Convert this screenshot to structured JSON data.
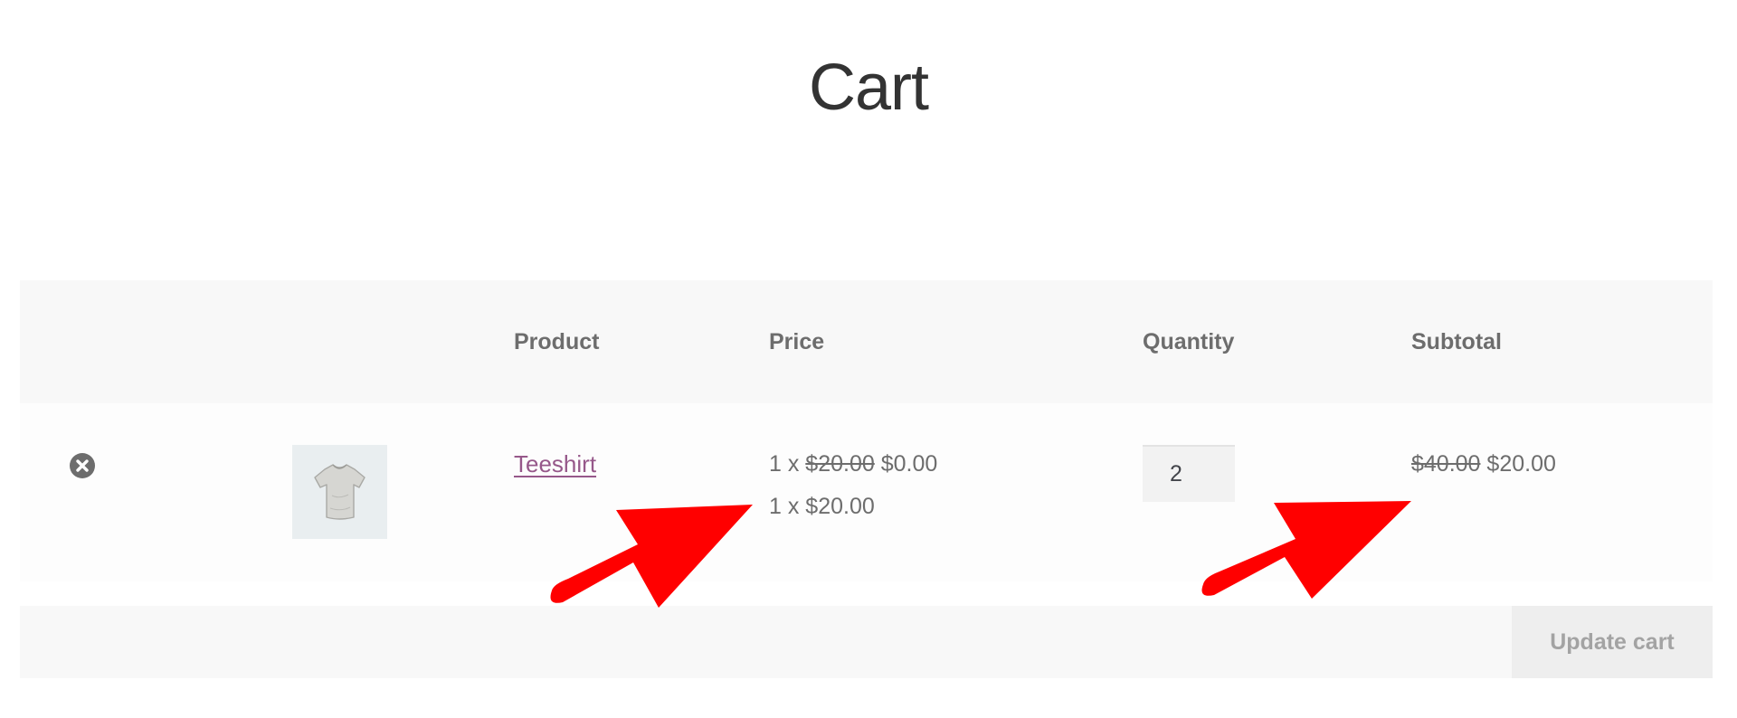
{
  "page": {
    "title": "Cart"
  },
  "table": {
    "headers": {
      "product": "Product",
      "price": "Price",
      "quantity": "Quantity",
      "subtotal": "Subtotal"
    },
    "rows": [
      {
        "product_name": "Teeshirt",
        "thumbnail_icon": "tshirt-icon",
        "price_lines": [
          {
            "prefix": "1 x ",
            "original": "$20.00",
            "current": " $0.00"
          },
          {
            "prefix": "1 x ",
            "original": "",
            "current": "$20.00"
          }
        ],
        "quantity": "2",
        "subtotal_original": "$40.00",
        "subtotal_current": " $20.00",
        "remove_icon": "remove-circle-icon"
      }
    ]
  },
  "actions": {
    "update_cart_label": "Update cart"
  },
  "annotations": {
    "arrow_color": "#ff0000"
  },
  "colors": {
    "link": "#96588a",
    "text": "#6d6d6d",
    "header_bg": "#f8f8f8"
  }
}
